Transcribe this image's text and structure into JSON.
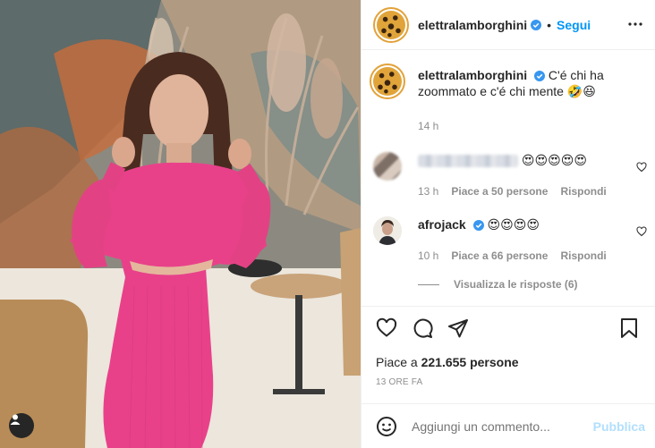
{
  "header": {
    "username": "elettralamborghini",
    "separator": "•",
    "follow_label": "Segui"
  },
  "caption": {
    "username": "elettralamborghini",
    "text": "C'é chi ha zoommato e c'é chi mente",
    "emojis": [
      "🤣",
      "😆"
    ],
    "time": "14 h"
  },
  "comments": [
    {
      "username": "",
      "username_blurred": true,
      "emojis": [
        "😍",
        "😍",
        "😍",
        "😍",
        "😍"
      ],
      "time": "13 h",
      "likes": "Piace a 50 persone",
      "reply": "Rispondi"
    },
    {
      "username": "afrojack",
      "username_blurred": false,
      "emojis": [
        "😍",
        "😍",
        "😍",
        "😍"
      ],
      "time": "10 h",
      "likes": "Piace a 66 persone",
      "reply": "Rispondi"
    }
  ],
  "view_replies": "Visualizza le risposte (6)",
  "likes_prefix": "Piace a",
  "likes_count": "221.655 persone",
  "post_time": "13 ORE FA",
  "add_comment": {
    "placeholder": "Aggiungi un commento...",
    "publish_label": "Pubblica"
  },
  "icons": {
    "verified": "verified-badge-icon",
    "more": "more-options-icon",
    "like": "heart-icon",
    "comment": "comment-icon",
    "share": "paper-plane-icon",
    "save": "bookmark-icon",
    "emoji": "smiley-icon",
    "tag": "user-tag-icon"
  },
  "colors": {
    "accent": "#0095f6",
    "publish_disabled": "#b2dffc",
    "secondary_text": "#8e8e8e",
    "dress": "#e8418a"
  }
}
